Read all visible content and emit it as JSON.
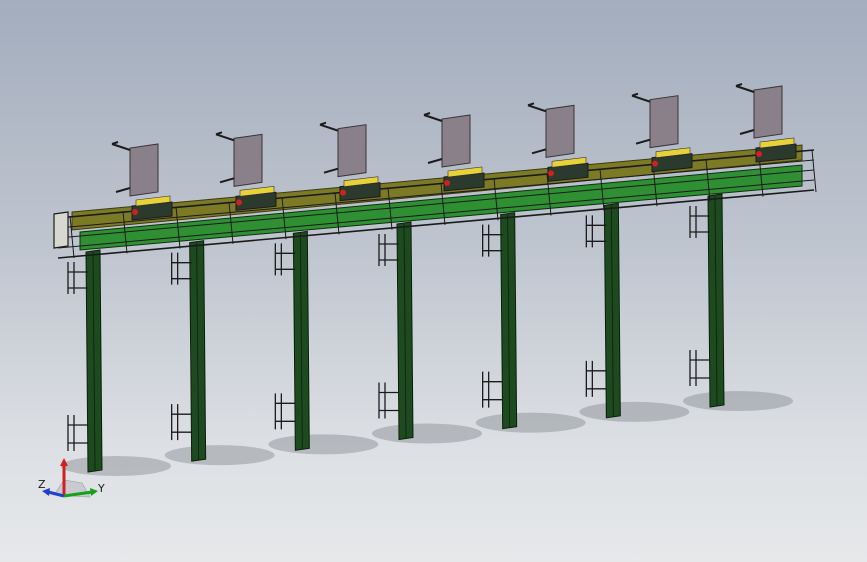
{
  "viewport": {
    "background_top": "#a3adbd",
    "background_bottom": "#e6e8ea"
  },
  "model": {
    "column_count": 7,
    "colors": {
      "column": "#1d4a1f",
      "column_edge": "#0c1f0c",
      "side_plate": "#7d7a25",
      "inner_belt": "#2f8f33",
      "upright_panel": "#8a8089",
      "rail": "#1b1b1b",
      "hazard_stripe": "#e8d23a",
      "indicator": "#cc2222",
      "shadow": "#6e7278"
    }
  },
  "triad": {
    "x_label": "Y",
    "z_label": "Z",
    "x_color": "#18a018",
    "y_color": "#d02020",
    "z_color": "#2040d0"
  }
}
